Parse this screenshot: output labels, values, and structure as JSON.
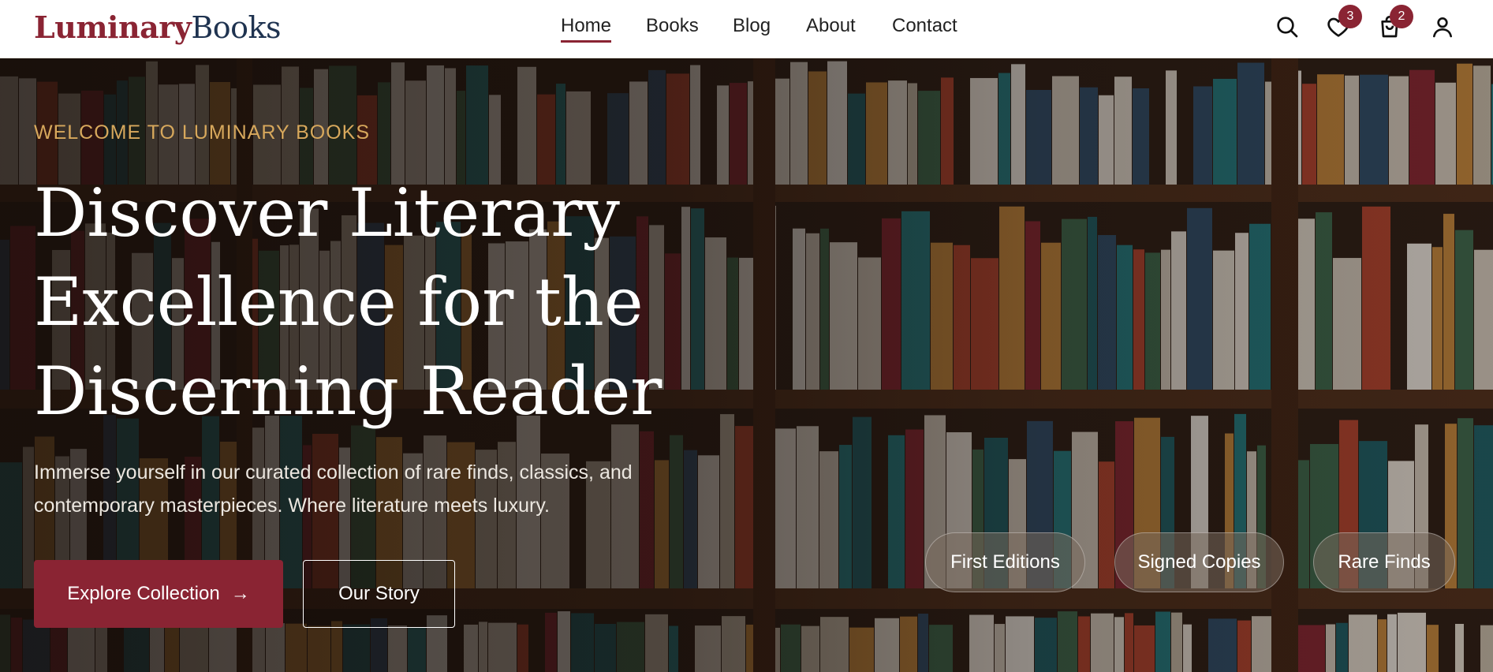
{
  "brand": {
    "part1": "Luminary",
    "part2": "Books"
  },
  "nav": [
    {
      "label": "Home",
      "active": true
    },
    {
      "label": "Books",
      "active": false
    },
    {
      "label": "Blog",
      "active": false
    },
    {
      "label": "About",
      "active": false
    },
    {
      "label": "Contact",
      "active": false
    }
  ],
  "header_icons": {
    "search": "search-icon",
    "wishlist": "heart-icon",
    "cart": "shopping-bag-icon",
    "account": "user-icon",
    "wishlist_count": "3",
    "cart_count": "2"
  },
  "hero": {
    "eyebrow": "WELCOME TO LUMINARY BOOKS",
    "headline_1": "Discover Literary",
    "headline_2": "Excellence for the",
    "headline_3": "Discerning Reader",
    "subtext": "Immerse yourself in our curated collection of rare finds, classics, and contemporary masterpieces. Where literature meets luxury.",
    "primary_button": "Explore Collection",
    "secondary_button": "Our Story",
    "tags": [
      "First Editions",
      "Signed Copies",
      "Rare Finds"
    ]
  },
  "colors": {
    "brand_red": "#8a2433",
    "brand_navy": "#1f3350",
    "eyebrow_gold": "#d7a85c"
  }
}
